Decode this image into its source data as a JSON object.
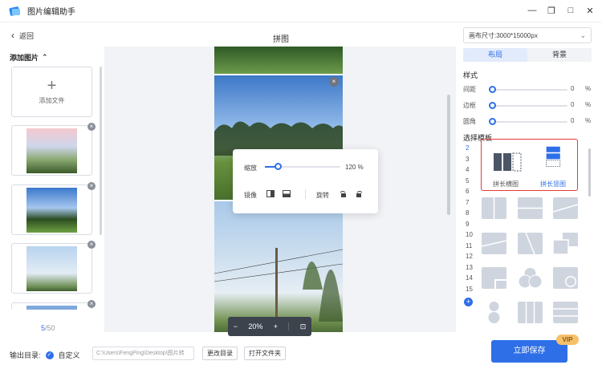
{
  "window": {
    "title": "图片编辑助手",
    "controls": [
      "—",
      "❐",
      "□",
      "✕"
    ]
  },
  "left": {
    "back_label": "返回",
    "add_header": "添加图片",
    "add_file_label": "添加文件",
    "count_current": "5",
    "count_total": "/50"
  },
  "center": {
    "title": "拼图",
    "popover": {
      "zoom_label": "缩放",
      "zoom_value": "120 %",
      "zoom_level": 0.2,
      "mirror_label": "镜像",
      "rotate_label": "旋转"
    },
    "zoombar": {
      "minus": "−",
      "value": "20%",
      "plus": "+"
    }
  },
  "right": {
    "canvas_size": "画布尺寸:3000*15000px",
    "tabs": [
      "布局",
      "背景"
    ],
    "style_header": "样式",
    "sliders": [
      {
        "label": "间距",
        "value": "0",
        "unit": "%"
      },
      {
        "label": "边框",
        "value": "0",
        "unit": "%"
      },
      {
        "label": "圆角",
        "value": "0",
        "unit": "%"
      }
    ],
    "template_header": "选择模板",
    "counts": [
      "2",
      "3",
      "4",
      "5",
      "6",
      "7",
      "8",
      "9",
      "10",
      "11",
      "12",
      "13",
      "14",
      "15"
    ],
    "templates": [
      {
        "label": "拼长横图"
      },
      {
        "label": "拼长竖图"
      }
    ]
  },
  "bottom": {
    "output_label": "输出目录:",
    "custom_label": "自定义",
    "path": "C:\\Users\\FengPing\\Desktop\\图片转",
    "change_dir": "更改目录",
    "open_folder": "打开文件夹",
    "save": "立即保存",
    "vip": "VIP"
  },
  "colors": {
    "accent": "#2e6fe8",
    "highlight": "#e53935"
  }
}
